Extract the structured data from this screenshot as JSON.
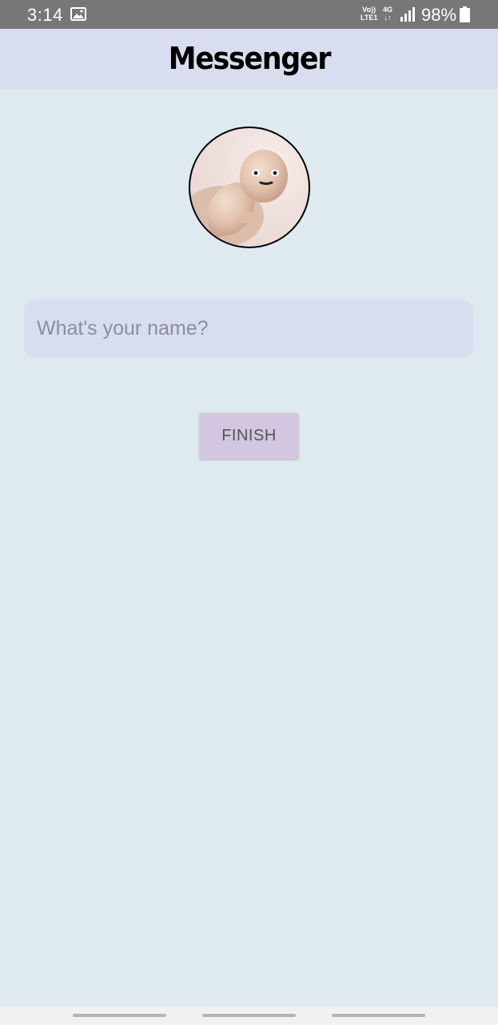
{
  "status_bar": {
    "time": "3:14",
    "volte_top": "Vo))",
    "volte_bottom": "LTE1",
    "network": "4G",
    "network_arrows": "↓↑",
    "battery": "98%"
  },
  "app_bar": {
    "title": "Messenger"
  },
  "profile": {
    "avatar_icon": "profile-photo"
  },
  "name_field": {
    "placeholder": "What's your name?",
    "value": ""
  },
  "finish_button": {
    "label": "FINISH"
  },
  "colors": {
    "background": "#dfe9f0",
    "app_bar": "#d8ddf0",
    "input_bg": "#d8ddf0",
    "button_bg": "#d2c6e0"
  }
}
